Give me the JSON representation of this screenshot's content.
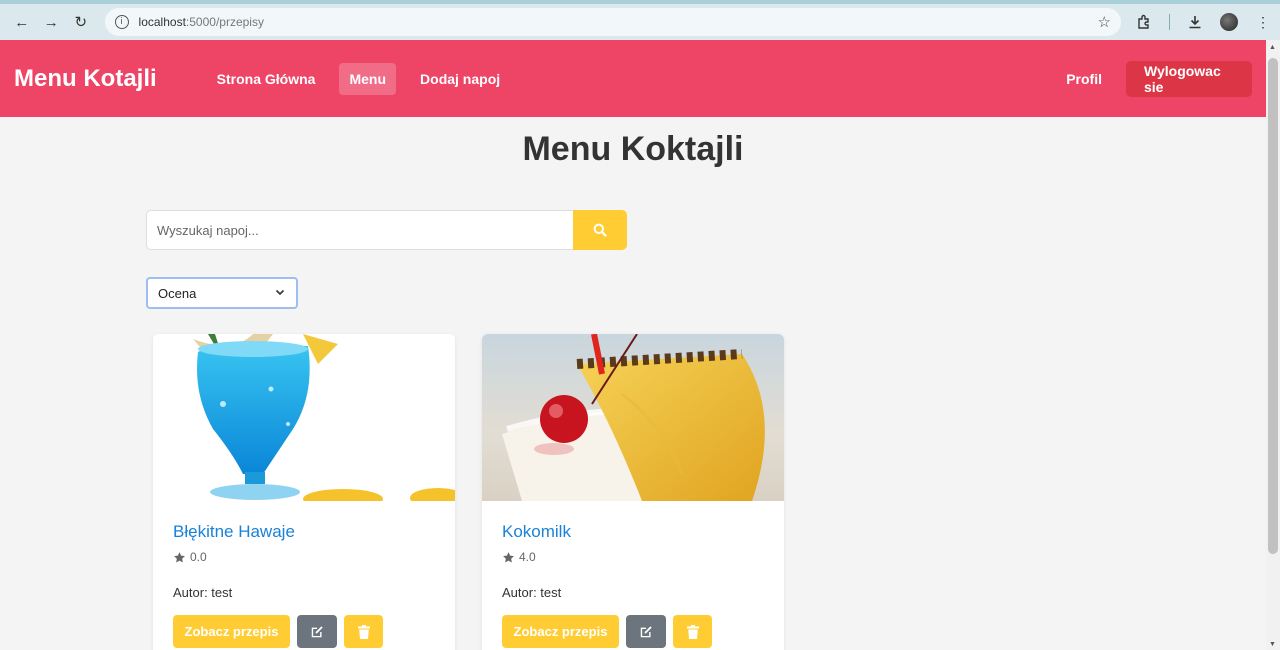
{
  "browser": {
    "url_host": "localhost",
    "url_path": ":5000/przepisy"
  },
  "navbar": {
    "brand": "Menu Kotajli",
    "links": [
      "Strona Główna",
      "Menu",
      "Dodaj napoj"
    ],
    "active": "Menu",
    "profile": "Profil",
    "logout": "Wylogowac sie",
    "color": "#ee4466"
  },
  "page": {
    "title": "Menu Koktajli"
  },
  "search": {
    "placeholder": "Wyszukaj napoj..."
  },
  "sort": {
    "selected": "Ocena"
  },
  "cards": [
    {
      "title": "Błękitne Hawaje",
      "rating": "0.0",
      "author": "Autor: test",
      "view_label": "Zobacz przepis",
      "image": "blue-cocktail-glass"
    },
    {
      "title": "Kokomilk",
      "rating": "4.0",
      "author": "Autor: test",
      "view_label": "Zobacz przepis",
      "image": "pineapple-milk-cocktail"
    }
  ],
  "colors": {
    "accent_yellow": "#ffcc33",
    "link_blue": "#1a82d8",
    "danger": "#dc3545"
  }
}
